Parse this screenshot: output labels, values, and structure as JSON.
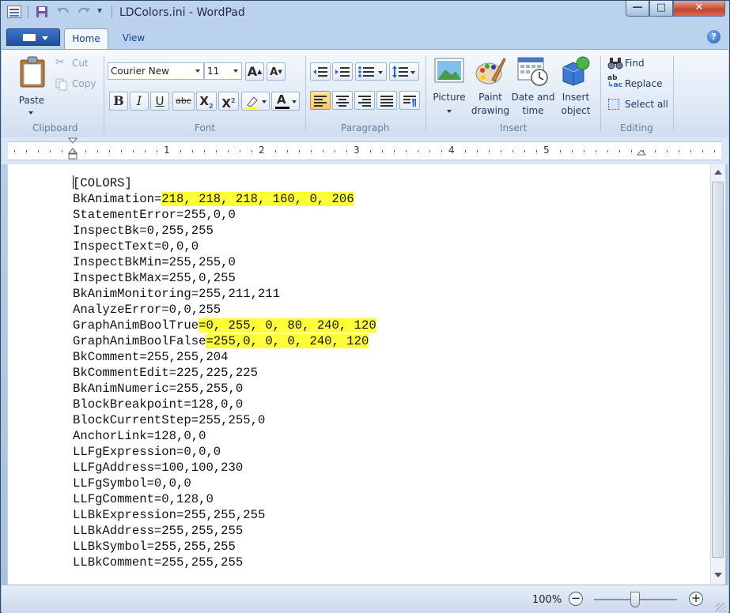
{
  "window": {
    "title": "LDColors.ini - WordPad",
    "controls": {
      "minimize": "—",
      "maximize": "□",
      "close": "✕"
    }
  },
  "quick_access": {
    "save_icon": "save-icon",
    "undo_icon": "undo-icon",
    "redo_icon": "redo-icon",
    "customize": "▾"
  },
  "tabs": [
    {
      "label": "Home",
      "active": true
    },
    {
      "label": "View",
      "active": false
    }
  ],
  "help": "?",
  "ribbon": {
    "clipboard": {
      "label": "Clipboard",
      "paste": "Paste",
      "cut": "Cut",
      "copy": "Copy"
    },
    "font": {
      "label": "Font",
      "family": "Courier New",
      "size": "11",
      "grow": "A",
      "shrink": "A",
      "bold": "B",
      "italic": "I",
      "underline": "U",
      "strikethrough": "abc",
      "subscript": "X",
      "superscript": "X",
      "font_color": "A"
    },
    "paragraph": {
      "label": "Paragraph"
    },
    "insert": {
      "label": "Insert",
      "picture": "Picture",
      "paint_line1": "Paint",
      "paint_line2": "drawing",
      "datetime_line1": "Date and",
      "datetime_line2": "time",
      "object_line1": "Insert",
      "object_line2": "object"
    },
    "editing": {
      "label": "Editing",
      "find": "Find",
      "replace": "Replace",
      "select_all": "Select all"
    }
  },
  "ruler": {
    "numbers": [
      "1",
      "2",
      "3",
      "4",
      "5"
    ]
  },
  "document": {
    "lines": [
      {
        "key": "[COLORS]",
        "value": ""
      },
      {
        "key": "BkAnimation=",
        "value": "218, 218, 218, 160, 0, 206",
        "highlight": true
      },
      {
        "key": "StatementError=255,0,0",
        "value": ""
      },
      {
        "key": "InspectBk=0,255,255",
        "value": ""
      },
      {
        "key": "InspectText=0,0,0",
        "value": ""
      },
      {
        "key": "InspectBkMin=255,255,0",
        "value": ""
      },
      {
        "key": "InspectBkMax=255,0,255",
        "value": ""
      },
      {
        "key": "BkAnimMonitoring=255,211,211",
        "value": ""
      },
      {
        "key": "AnalyzeError=0,0,255",
        "value": ""
      },
      {
        "key": "GraphAnimBoolTrue",
        "value": "=0, 255, 0, 80, 240, 120",
        "highlight": true
      },
      {
        "key": "GraphAnimBoolFalse",
        "value": "=255,0, 0, 0, 240, 120",
        "highlight": true
      },
      {
        "key": "BkComment=255,255,204",
        "value": ""
      },
      {
        "key": "BkCommentEdit=225,225,225",
        "value": ""
      },
      {
        "key": "BkAnimNumeric=255,255,0",
        "value": ""
      },
      {
        "key": "BlockBreakpoint=128,0,0",
        "value": ""
      },
      {
        "key": "BlockCurrentStep=255,255,0",
        "value": ""
      },
      {
        "key": "AnchorLink=128,0,0",
        "value": ""
      },
      {
        "key": "LLFgExpression=0,0,0",
        "value": ""
      },
      {
        "key": "LLFgAddress=100,100,230",
        "value": ""
      },
      {
        "key": "LLFgSymbol=0,0,0",
        "value": ""
      },
      {
        "key": "LLFgComment=0,128,0",
        "value": ""
      },
      {
        "key": "LLBkExpression=255,255,255",
        "value": ""
      },
      {
        "key": "LLBkAddress=255,255,255",
        "value": ""
      },
      {
        "key": "LLBkSymbol=255,255,255",
        "value": ""
      },
      {
        "key": "LLBkComment=255,255,255",
        "value": ""
      }
    ]
  },
  "status": {
    "zoom": "100%",
    "zoom_out": "−",
    "zoom_in": "+"
  },
  "colors": {
    "highlight": "#ffff38",
    "accent": "#1f4f9f"
  }
}
